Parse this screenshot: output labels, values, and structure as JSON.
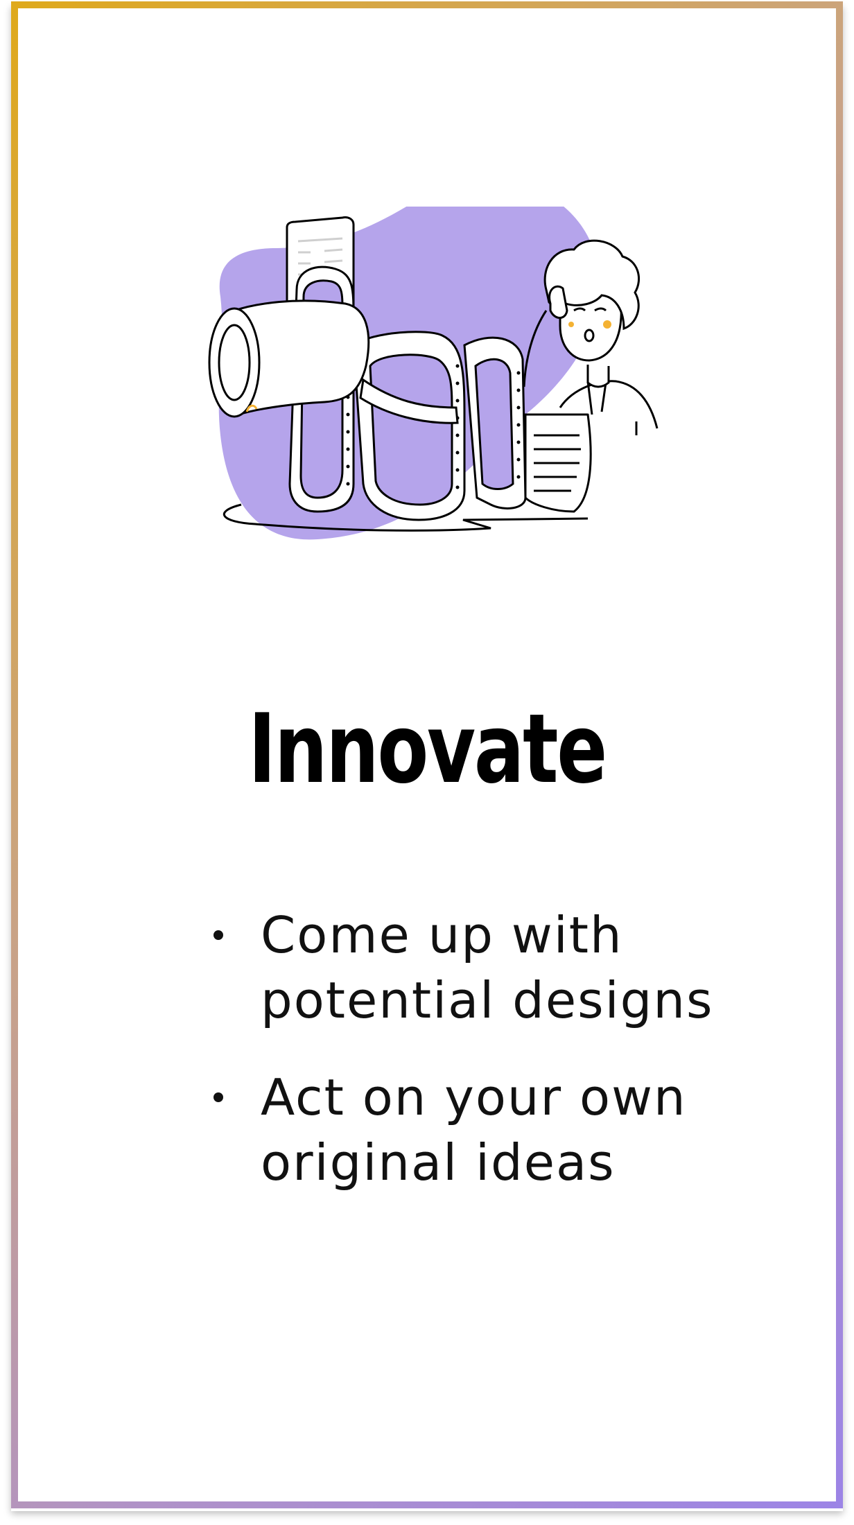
{
  "card": {
    "border_gradient": [
      "#dfa91b",
      "#c9a386",
      "#b092c8",
      "#9c84e6"
    ],
    "background": "#ffffff"
  },
  "illustration": {
    "icon": "person-with-long-receipt-icon",
    "blob_color": "#b5a4eb",
    "accent_color": "#f4b233"
  },
  "title": "Innovate",
  "bullets": [
    {
      "text": "Come up with potential designs"
    },
    {
      "text": "Act on your own original ideas"
    }
  ]
}
